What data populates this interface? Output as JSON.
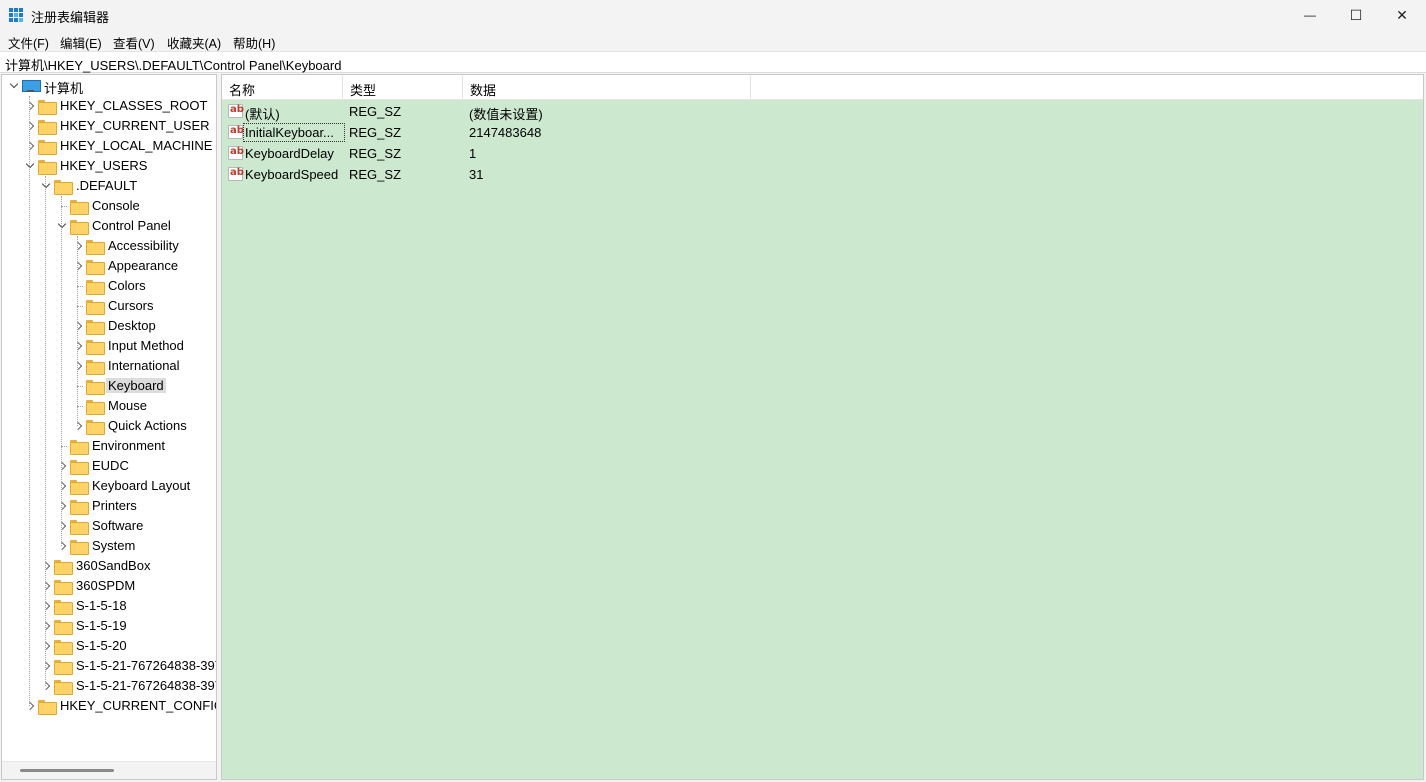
{
  "window": {
    "title": "注册表编辑器",
    "minimize_symbol": "—",
    "maximize_symbol": "☐",
    "close_symbol": "✕"
  },
  "menu": [
    "文件(F)",
    "编辑(E)",
    "查看(V)",
    "收藏夹(A)",
    "帮助(H)"
  ],
  "address": "计算机\\HKEY_USERS\\.DEFAULT\\Control Panel\\Keyboard",
  "tree": [
    {
      "label": "计算机",
      "expander": "down",
      "icon": "computer-icon"
    },
    {
      "label": "HKEY_CLASSES_ROOT",
      "expander": "right",
      "icon": "folder-icon"
    },
    {
      "label": "HKEY_CURRENT_USER",
      "expander": "right",
      "icon": "folder-icon"
    },
    {
      "label": "HKEY_LOCAL_MACHINE",
      "expander": "right",
      "icon": "folder-icon"
    },
    {
      "label": "HKEY_USERS",
      "expander": "down",
      "icon": "folder-icon"
    },
    {
      "label": ".DEFAULT",
      "expander": "down",
      "icon": "folder-icon"
    },
    {
      "label": "Console",
      "expander": "none",
      "icon": "folder-icon"
    },
    {
      "label": "Control Panel",
      "expander": "down",
      "icon": "folder-icon"
    },
    {
      "label": "Accessibility",
      "expander": "right",
      "icon": "folder-icon"
    },
    {
      "label": "Appearance",
      "expander": "right",
      "icon": "folder-icon"
    },
    {
      "label": "Colors",
      "expander": "none",
      "icon": "folder-icon"
    },
    {
      "label": "Cursors",
      "expander": "none",
      "icon": "folder-icon"
    },
    {
      "label": "Desktop",
      "expander": "right",
      "icon": "folder-icon"
    },
    {
      "label": "Input Method",
      "expander": "right",
      "icon": "folder-icon"
    },
    {
      "label": "International",
      "expander": "right",
      "icon": "folder-icon"
    },
    {
      "label": "Keyboard",
      "expander": "none",
      "icon": "folder-icon",
      "selected": true
    },
    {
      "label": "Mouse",
      "expander": "none",
      "icon": "folder-icon"
    },
    {
      "label": "Quick Actions",
      "expander": "right",
      "icon": "folder-icon"
    },
    {
      "label": "Environment",
      "expander": "none",
      "icon": "folder-icon"
    },
    {
      "label": "EUDC",
      "expander": "right",
      "icon": "folder-icon"
    },
    {
      "label": "Keyboard Layout",
      "expander": "right",
      "icon": "folder-icon"
    },
    {
      "label": "Printers",
      "expander": "right",
      "icon": "folder-icon"
    },
    {
      "label": "Software",
      "expander": "right",
      "icon": "folder-icon"
    },
    {
      "label": "System",
      "expander": "right",
      "icon": "folder-icon"
    },
    {
      "label": "360SandBox",
      "expander": "right",
      "icon": "folder-icon"
    },
    {
      "label": "360SPDM",
      "expander": "right",
      "icon": "folder-icon"
    },
    {
      "label": "S-1-5-18",
      "expander": "right",
      "icon": "folder-icon"
    },
    {
      "label": "S-1-5-19",
      "expander": "right",
      "icon": "folder-icon"
    },
    {
      "label": "S-1-5-20",
      "expander": "right",
      "icon": "folder-icon"
    },
    {
      "label": "S-1-5-21-767264838-397",
      "expander": "right",
      "icon": "folder-icon"
    },
    {
      "label": "S-1-5-21-767264838-397",
      "expander": "right",
      "icon": "folder-icon"
    },
    {
      "label": "HKEY_CURRENT_CONFIG",
      "expander": "right",
      "icon": "folder-icon"
    }
  ],
  "list": {
    "columns": [
      "名称",
      "类型",
      "数据"
    ],
    "rows": [
      {
        "name": "(默认)",
        "type": "REG_SZ",
        "data": "(数值未设置)",
        "icon": "string-value-icon"
      },
      {
        "name": "InitialKeyboar...",
        "type": "REG_SZ",
        "data": "2147483648",
        "icon": "string-value-icon",
        "focused": true
      },
      {
        "name": "KeyboardDelay",
        "type": "REG_SZ",
        "data": "1",
        "icon": "string-value-icon"
      },
      {
        "name": "KeyboardSpeed",
        "type": "REG_SZ",
        "data": "31",
        "icon": "string-value-icon"
      }
    ]
  },
  "colors": {
    "list_background": "#cce8cf",
    "folder": "#ffd365",
    "selection": "#dcdcdc",
    "value_icon_text": "#c0392b"
  }
}
